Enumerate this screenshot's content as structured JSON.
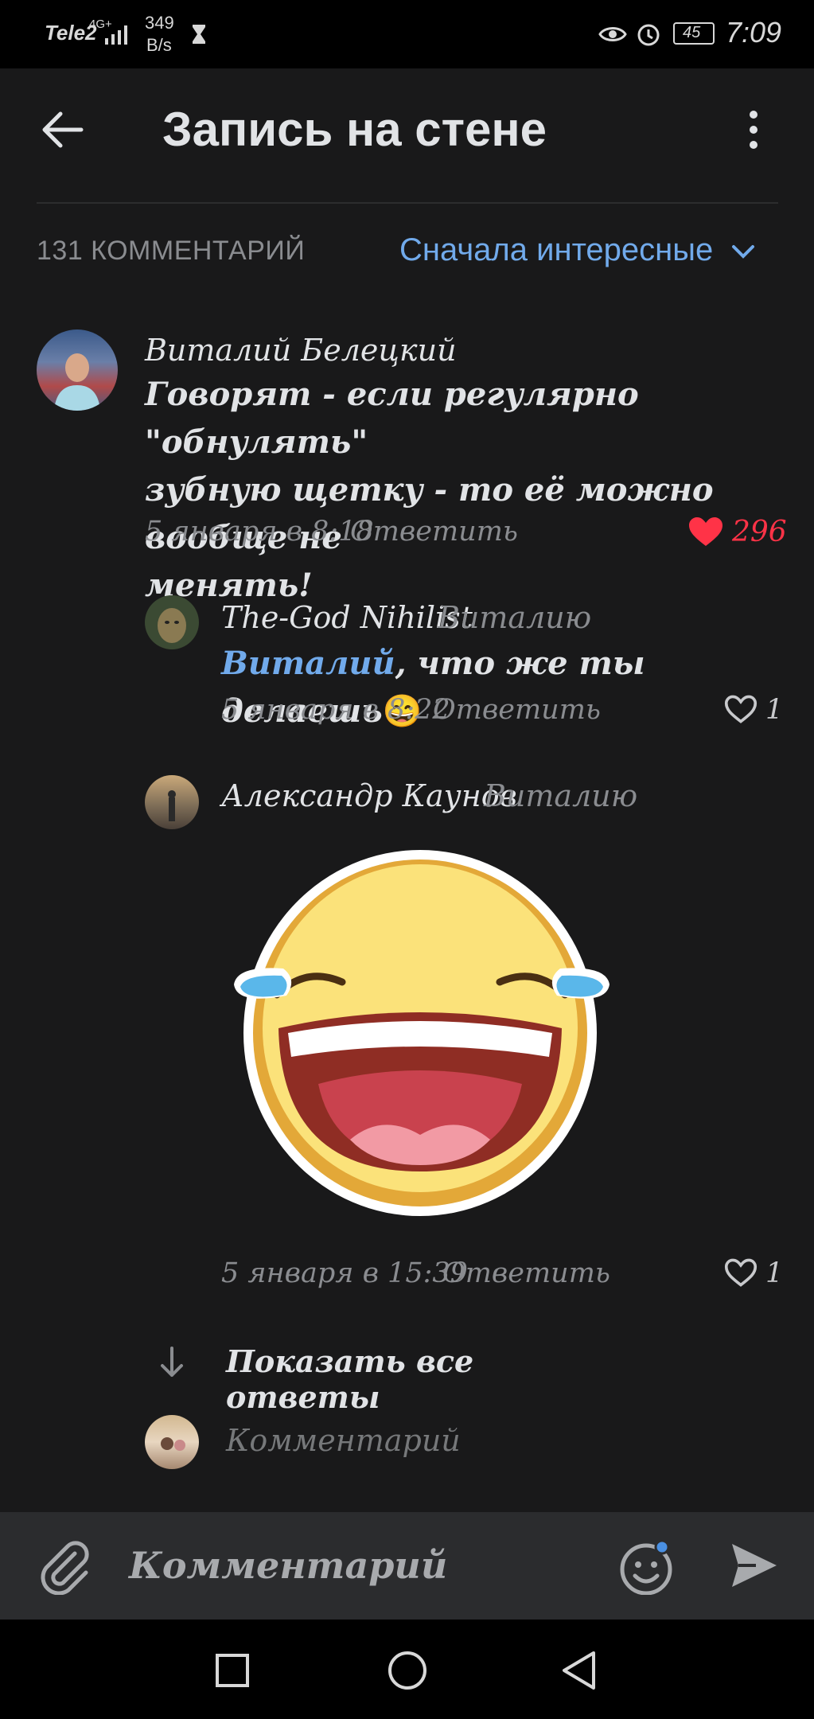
{
  "status_bar": {
    "carrier": "Tele2",
    "network": "4G+",
    "speed_value": "349",
    "speed_unit": "B/s",
    "battery": "45",
    "time": "7:09"
  },
  "header": {
    "title": "Запись на стене"
  },
  "comments_bar": {
    "count_label": "131 КОММЕНТАРИЙ",
    "sort_label": "Сначала интересные"
  },
  "comment": {
    "author": "Виталий Белецкий",
    "lines": [
      "Говорят - если регулярно \"обнулять\"",
      "зубную щетку - то её можно вообще не",
      "менять!"
    ],
    "date": "5 января в 8:18",
    "reply_label": "Ответить",
    "likes": "296"
  },
  "replies": [
    {
      "author": "The-God Nihilist",
      "to": "Виталию",
      "mention": "Виталий",
      "text": ", что же ты делаешь",
      "emoji": "😄",
      "date": "5 января в 8:22",
      "reply_label": "Ответить",
      "likes": "1"
    },
    {
      "author": "Александр Каунов",
      "to": "Виталию",
      "sticker": "laughing-crying-emoji-sticker",
      "date": "5 января в 15:39",
      "reply_label": "Ответить",
      "likes": "1"
    }
  ],
  "show_all": {
    "label": "Показать все ответы"
  },
  "reply_input": {
    "placeholder": "Комментарий"
  },
  "composer": {
    "placeholder": "Комментарий"
  },
  "colors": {
    "accent": "#71aaeb",
    "like_active": "#ff3347",
    "background": "#19191a"
  }
}
